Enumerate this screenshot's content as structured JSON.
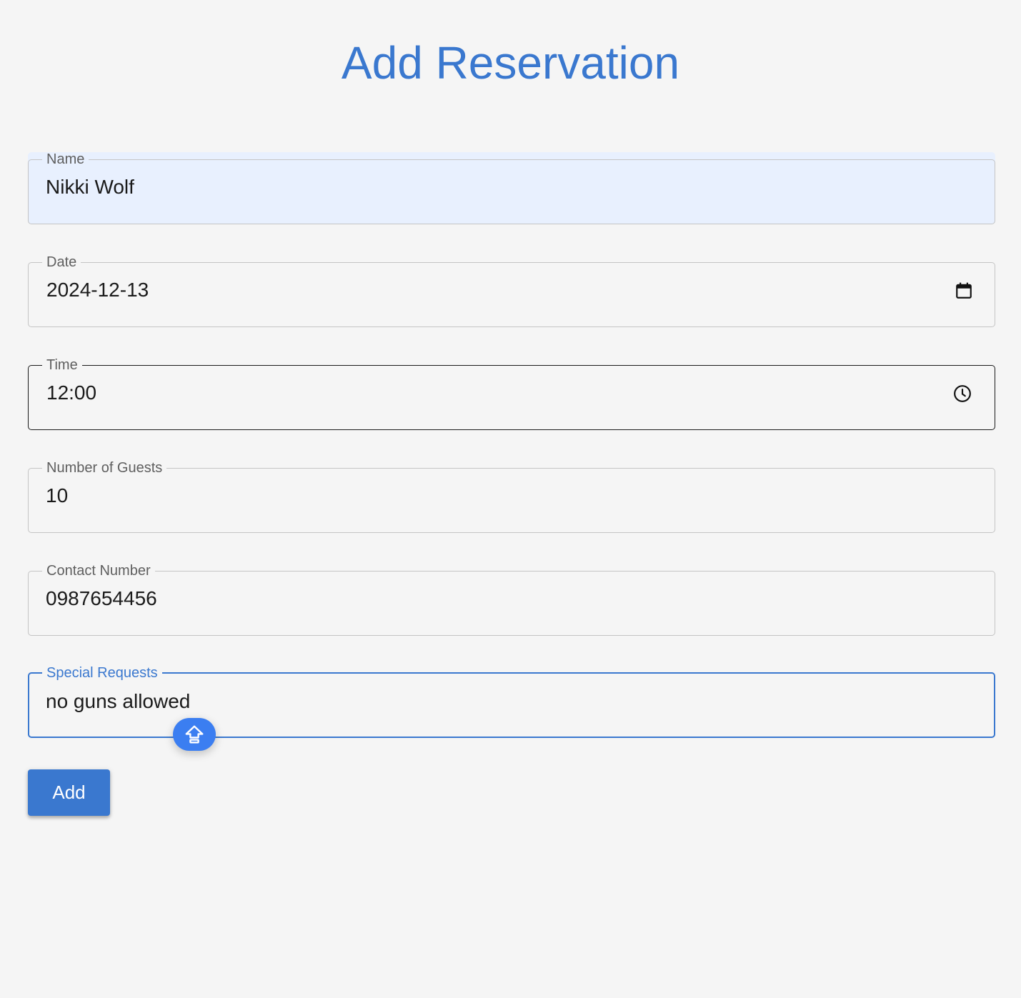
{
  "page": {
    "title": "Add Reservation"
  },
  "form": {
    "name": {
      "label": "Name",
      "value": "Nikki Wolf"
    },
    "date": {
      "label": "Date",
      "value": "2024-12-13"
    },
    "time": {
      "label": "Time",
      "value": "12:00"
    },
    "guests": {
      "label": "Number of Guests",
      "value": "10"
    },
    "contact": {
      "label": "Contact Number",
      "value": "0987654456"
    },
    "requests": {
      "label": "Special Requests",
      "value": "no guns allowed"
    }
  },
  "actions": {
    "add_label": "Add"
  },
  "icons": {
    "date_picker": "calendar-icon",
    "time_picker": "clock-icon",
    "floating_helper": "shift-arrow-up-icon"
  },
  "colors": {
    "accent": "#3a78cf",
    "floating_button": "#3b7ef1",
    "autofill_background": "#e8f0fe",
    "background": "#f5f5f5"
  }
}
